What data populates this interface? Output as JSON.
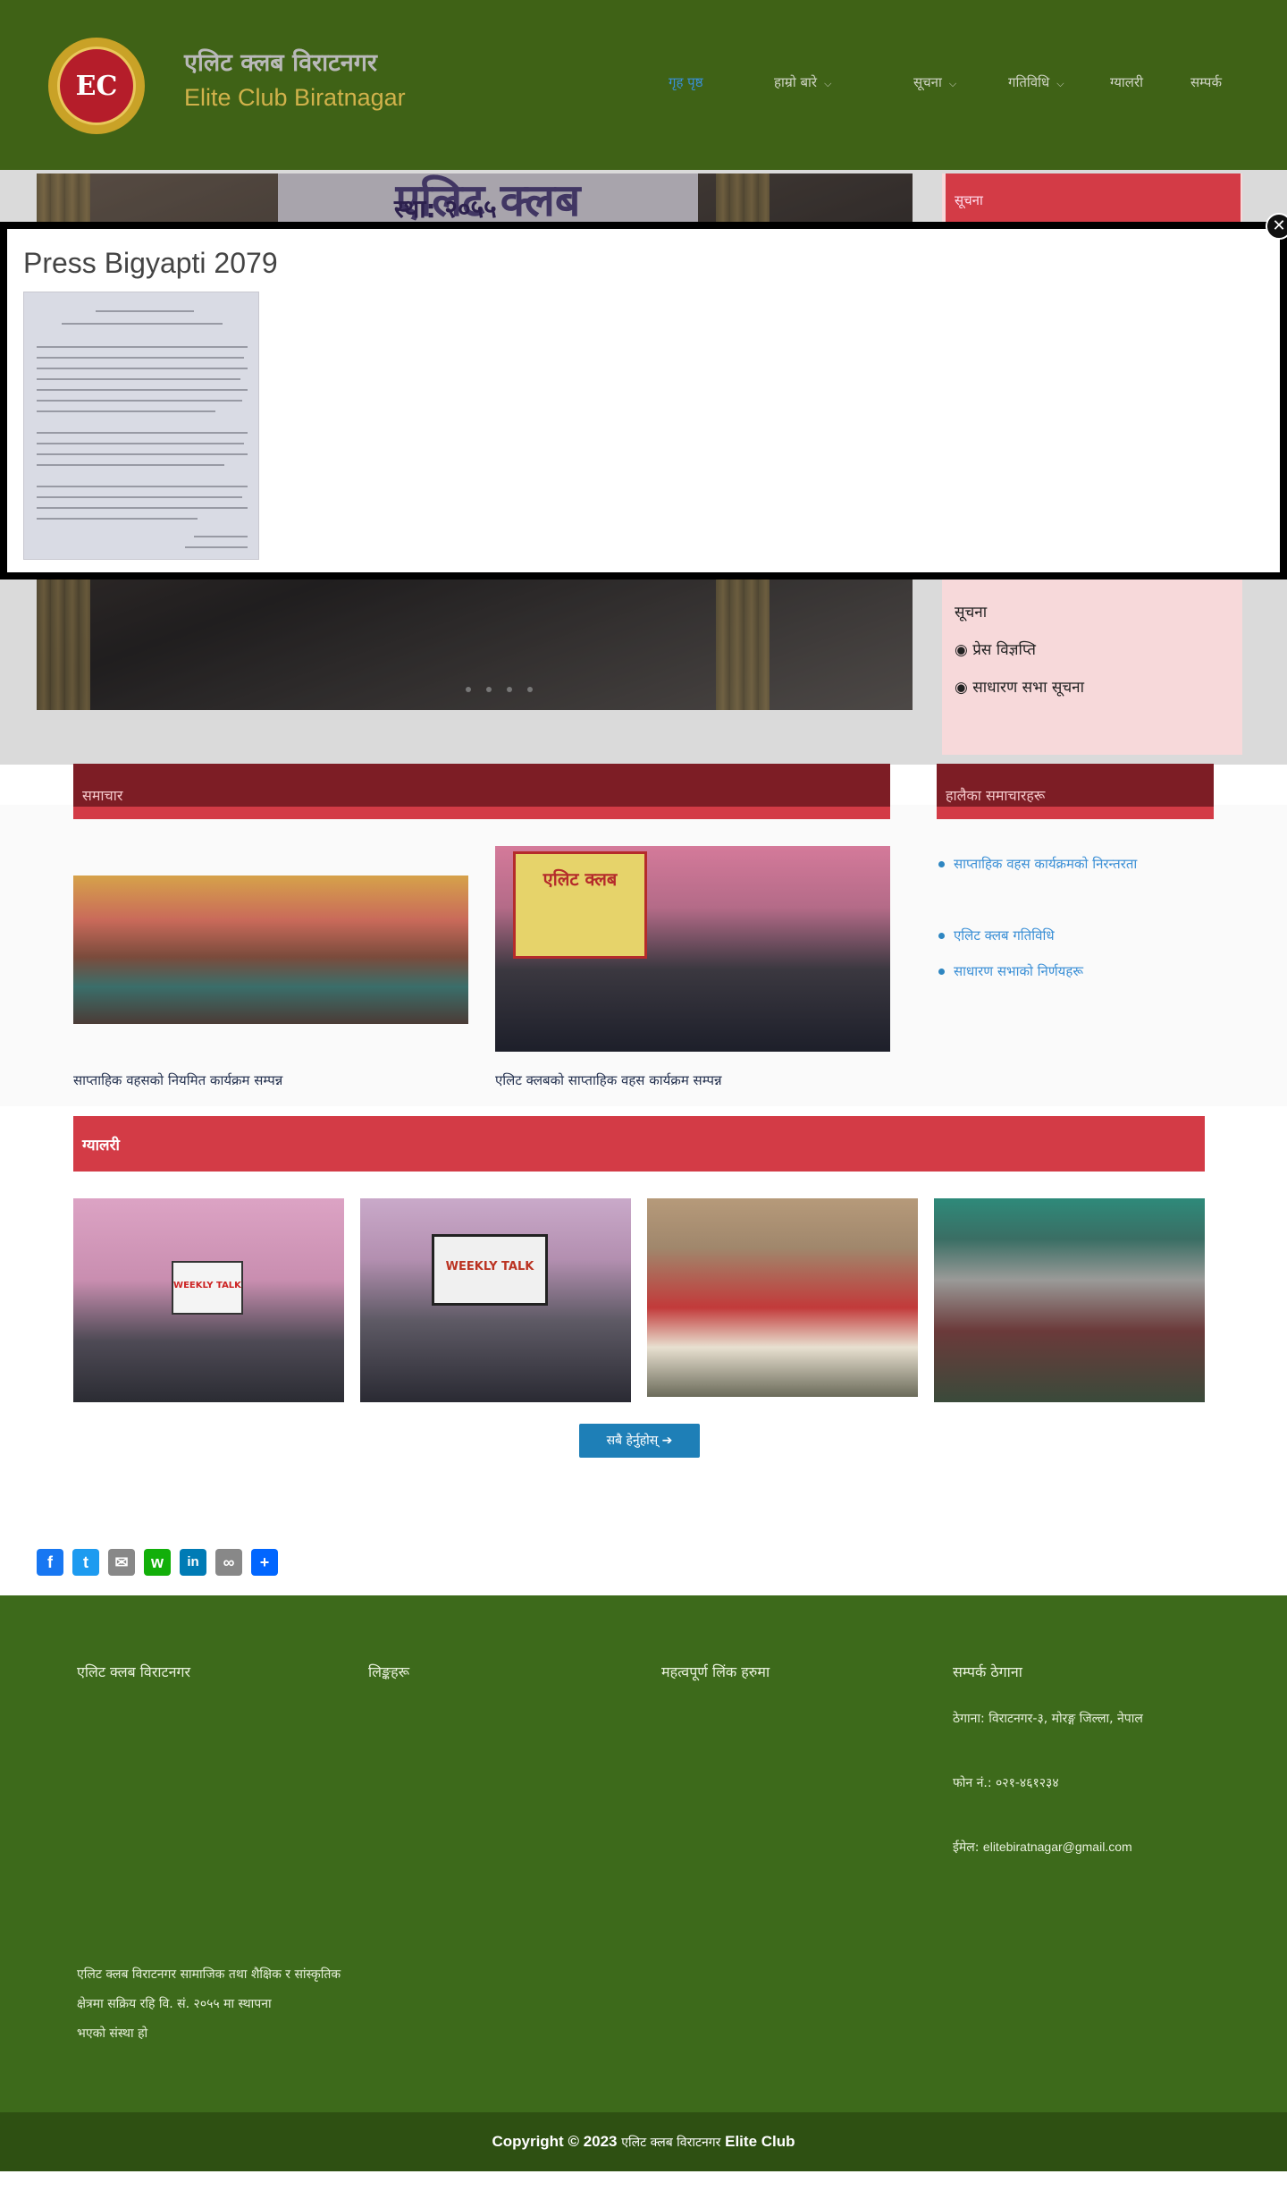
{
  "header": {
    "site_title": "एलिट क्लब विराटनगर",
    "site_subtitle": "Elite Club Biratnagar",
    "logo_text": "EC",
    "nav": [
      "गृह पृष्ठ",
      "हाम्रो बारे",
      "सूचना",
      "गतिविधि",
      "ग्यालरी",
      "सम्पर्क"
    ]
  },
  "hero": {
    "banner_text": "एलिट क्लब",
    "banner_year": "स्था: २०५५"
  },
  "side_notice": {
    "title": "सूचना",
    "group_label": "सूचना",
    "items": [
      "◉ प्रेस विज्ञप्ति",
      "◉ साधारण सभा सूचना"
    ]
  },
  "modal": {
    "title": "Press Bigyapti 2079",
    "close_symbol": "✕"
  },
  "news": {
    "section_title": "समाचार",
    "captions": [
      "साप्ताहिक वहसको नियमित कार्यक्रम सम्पन्न",
      "एलिट क्लबको साप्ताहिक वहस कार्यक्रम सम्पन्न"
    ],
    "photo_banner_text": "एलिट क्लब"
  },
  "sidebar_news": {
    "title": "हालैका समाचारहरू",
    "links": [
      "साप्ताहिक वहस कार्यक्रमको निरन्तरता",
      "एलिट क्लब गतिविधि",
      "साधारण सभाको निर्णयहरू"
    ]
  },
  "gallery": {
    "title": "ग्यालरी",
    "more_button": "सबै हेर्नुहोस्",
    "more_icon": "➔",
    "weekly_talk_text": "WEEKLY TALK"
  },
  "share": {
    "items": [
      {
        "name": "facebook",
        "glyph": "f",
        "color": "#1877f2"
      },
      {
        "name": "twitter",
        "glyph": "t",
        "color": "#1d9bf0"
      },
      {
        "name": "email",
        "glyph": "✉",
        "color": "#888888"
      },
      {
        "name": "whatsapp",
        "glyph": "w",
        "color": "#12af0a"
      },
      {
        "name": "linkedin",
        "glyph": "in",
        "color": "#007bb5"
      },
      {
        "name": "copy-link",
        "glyph": "∞",
        "color": "#888888"
      },
      {
        "name": "share",
        "glyph": "+",
        "color": "#0166ff"
      }
    ]
  },
  "footer": {
    "col1_title": "एलिट क्लब विराटनगर",
    "col2_title": "लिङ्कहरू",
    "col3_title": "महत्वपूर्ण लिंक हरुमा",
    "col4_title": "सम्पर्क ठेगाना",
    "address": "ठेगाना: विराटनगर-३, मोरङ्ग जिल्ला, नेपाल",
    "phone": "फोन नं.: ०२१-४६१२३४",
    "email_label": "ईमेल:",
    "email_value": "elitebiratnagar@gmail.com",
    "about_lines": [
      "एलिट क्लब विराटनगर सामाजिक तथा शैक्षिक र सांस्कृतिक",
      "क्षेत्रमा सक्रिय रहि वि. सं. २०५५ मा स्थापना",
      "भएको संस्था हो"
    ]
  },
  "copyright": {
    "text_prefix": "Copyright © 2023",
    "text_org": "एलिट क्लब विराटनगर",
    "text_suffix": "Elite Club"
  },
  "colors": {
    "header_bg": "#3f6216",
    "footer_bg": "#3d6a1b",
    "accent_red": "#d33b46",
    "dark_red": "#7d1d25",
    "link_blue": "#3a8fd6"
  }
}
